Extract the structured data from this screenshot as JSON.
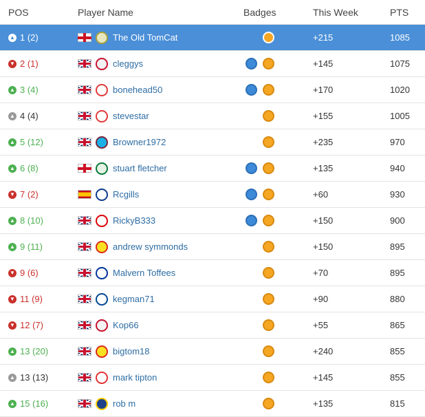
{
  "header": {
    "pos": "POS",
    "player": "Player Name",
    "badges": "Badges",
    "week": "This Week",
    "pts": "PTS"
  },
  "colors": {
    "highlight": "#4a8fd8",
    "up": "#4cb050",
    "down": "#c9302c",
    "same": "#999999",
    "link": "#2e6da4"
  },
  "rows": [
    {
      "pos": "1 (2)",
      "trend": "up",
      "flag": "eng",
      "crest": [
        "#a8a040",
        "#e8e8c0"
      ],
      "name": "The Old TomCat",
      "badges": [
        "gold"
      ],
      "week": "+215",
      "pts": "1085",
      "highlight": true
    },
    {
      "pos": "2 (1)",
      "trend": "down",
      "flag": "uk",
      "crest": [
        "#c8102e",
        "#f3f3f3"
      ],
      "name": "cleggys",
      "badges": [
        "blue",
        "gold"
      ],
      "week": "+145",
      "pts": "1075"
    },
    {
      "pos": "3 (4)",
      "trend": "up",
      "flag": "uk",
      "crest": [
        "#e23a3a",
        "#ffffff"
      ],
      "name": "bonehead50",
      "badges": [
        "blue",
        "gold"
      ],
      "week": "+170",
      "pts": "1020"
    },
    {
      "pos": "4 (4)",
      "trend": "same",
      "flag": "uk",
      "crest": [
        "#e23a3a",
        "#ffffff"
      ],
      "name": "stevestar",
      "badges": [
        "gold"
      ],
      "week": "+155",
      "pts": "1005"
    },
    {
      "pos": "5 (12)",
      "trend": "up",
      "flag": "uk",
      "crest": [
        "#7a263a",
        "#1bb1e7"
      ],
      "name": "Browner1972",
      "badges": [
        "gold"
      ],
      "week": "+235",
      "pts": "970"
    },
    {
      "pos": "6 (8)",
      "trend": "up",
      "flag": "eng",
      "crest": [
        "#0a7a3a",
        "#e6f2e6"
      ],
      "name": "stuart fletcher",
      "badges": [
        "blue",
        "gold"
      ],
      "week": "+135",
      "pts": "940"
    },
    {
      "pos": "7 (2)",
      "trend": "down",
      "flag": "esp",
      "crest": [
        "#0b3b8c",
        "#ffffff"
      ],
      "name": "Rcgills",
      "badges": [
        "blue",
        "gold"
      ],
      "week": "+60",
      "pts": "930"
    },
    {
      "pos": "8 (10)",
      "trend": "up",
      "flag": "uk",
      "crest": [
        "#db0007",
        "#ffffff"
      ],
      "name": "RickyB333",
      "badges": [
        "blue",
        "gold"
      ],
      "week": "+150",
      "pts": "900"
    },
    {
      "pos": "9 (11)",
      "trend": "up",
      "flag": "uk",
      "crest": [
        "#da291c",
        "#fbe122"
      ],
      "name": "andrew symmonds",
      "badges": [
        "gold"
      ],
      "week": "+150",
      "pts": "895"
    },
    {
      "pos": "9 (6)",
      "trend": "down",
      "flag": "uk",
      "crest": [
        "#003399",
        "#ffffff"
      ],
      "name": "Malvern Toffees",
      "badges": [
        "gold"
      ],
      "week": "+70",
      "pts": "895"
    },
    {
      "pos": "11 (9)",
      "trend": "down",
      "flag": "uk",
      "crest": [
        "#034694",
        "#ffffff"
      ],
      "name": "kegman71",
      "badges": [
        "gold"
      ],
      "week": "+90",
      "pts": "880"
    },
    {
      "pos": "12 (7)",
      "trend": "down",
      "flag": "uk",
      "crest": [
        "#c8102e",
        "#f3f3f3"
      ],
      "name": "Kop66",
      "badges": [
        "gold"
      ],
      "week": "+55",
      "pts": "865"
    },
    {
      "pos": "13 (20)",
      "trend": "up",
      "flag": "uk",
      "crest": [
        "#da291c",
        "#fbe122"
      ],
      "name": "bigtom18",
      "badges": [
        "gold"
      ],
      "week": "+240",
      "pts": "855"
    },
    {
      "pos": "13 (13)",
      "trend": "same",
      "flag": "uk",
      "crest": [
        "#e53233",
        "#ffffff"
      ],
      "name": "mark tipton",
      "badges": [
        "gold"
      ],
      "week": "+145",
      "pts": "855"
    },
    {
      "pos": "15 (16)",
      "trend": "up",
      "flag": "uk",
      "crest": [
        "#ffcd00",
        "#1d428a"
      ],
      "name": "rob m",
      "badges": [
        "gold"
      ],
      "week": "+135",
      "pts": "815"
    }
  ]
}
